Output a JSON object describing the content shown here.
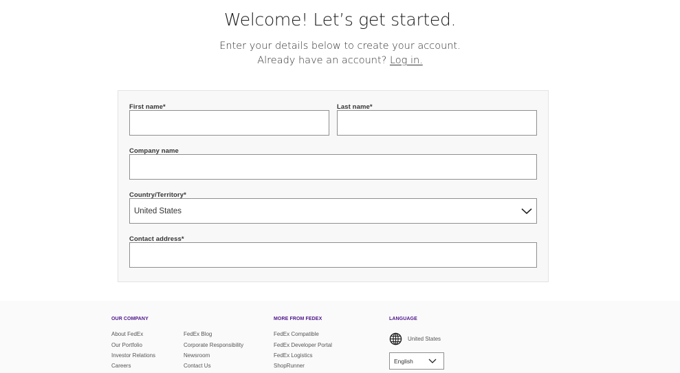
{
  "header": {
    "title": "Welcome! Let’s get started.",
    "subtitle": "Enter your details below to create your account.",
    "login_prompt": "Already have an account?",
    "login_link": "Log in."
  },
  "form": {
    "first_name": {
      "label": "First name*",
      "value": ""
    },
    "last_name": {
      "label": "Last name*",
      "value": ""
    },
    "company_name": {
      "label": "Company name",
      "value": ""
    },
    "country": {
      "label": "Country/Territory*",
      "selected": "United States",
      "icon": "chevron-down-icon"
    },
    "contact_address": {
      "label": "Contact address*",
      "value": ""
    }
  },
  "footer": {
    "our_company": {
      "heading": "OUR COMPANY",
      "links_col1": [
        "About FedEx",
        "Our Portfolio",
        "Investor Relations",
        "Careers"
      ],
      "links_col2": [
        "FedEx Blog",
        "Corporate Responsibility",
        "Newsroom",
        "Contact Us"
      ]
    },
    "more_from_fedex": {
      "heading": "MORE FROM FEDEX",
      "links": [
        "FedEx Compatible",
        "FedEx Developer Portal",
        "FedEx Logistics",
        "ShopRunner"
      ]
    },
    "language": {
      "heading": "LANGUAGE",
      "region": "United States",
      "region_icon": "globe-icon",
      "selected_language": "English"
    }
  },
  "colors": {
    "accent_purple": "#4d148c",
    "card_background": "#f8f8f8",
    "footer_background": "#fafafa",
    "input_border": "#8e8e8e"
  }
}
